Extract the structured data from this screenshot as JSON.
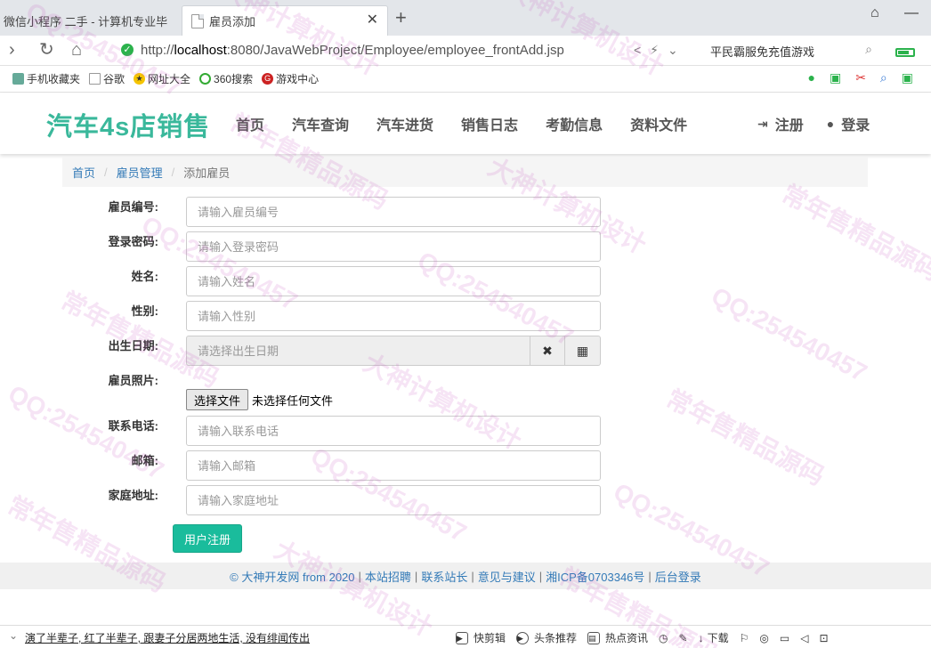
{
  "browser": {
    "tabs": [
      {
        "label": "微信小程序 二手 - 计算机专业毕",
        "active": false
      },
      {
        "label": "雇员添加",
        "active": true
      }
    ],
    "url_prefix": "http://",
    "url_host": "localhost",
    "url_path": ":8080/JavaWebProject/Employee/employee_frontAdd.jsp",
    "search_text": "平民霸服免充值游戏",
    "bookmarks": [
      {
        "label": "手机收藏夹",
        "icon": "phone-icon"
      },
      {
        "label": "谷歌",
        "icon": "page-icon"
      },
      {
        "label": "网址大全",
        "icon": "star-icon"
      },
      {
        "label": "360搜索",
        "icon": "search-360-icon"
      },
      {
        "label": "游戏中心",
        "icon": "game-icon"
      }
    ]
  },
  "site": {
    "logo": "汽车4s店销售",
    "nav": [
      "首页",
      "汽车查询",
      "汽车进货",
      "销售日志",
      "考勤信息",
      "资料文件"
    ],
    "register": "注册",
    "login": "登录"
  },
  "breadcrumb": {
    "home": "首页",
    "section": "雇员管理",
    "current": "添加雇员"
  },
  "form": {
    "employee_no": {
      "label": "雇员编号:",
      "placeholder": "请输入雇员编号"
    },
    "password": {
      "label": "登录密码:",
      "placeholder": "请输入登录密码"
    },
    "name": {
      "label": "姓名:",
      "placeholder": "请输入姓名"
    },
    "gender": {
      "label": "性别:",
      "placeholder": "请输入性别"
    },
    "birthday": {
      "label": "出生日期:",
      "placeholder": "请选择出生日期"
    },
    "photo": {
      "label": "雇员照片:",
      "button": "选择文件",
      "status": "未选择任何文件"
    },
    "phone": {
      "label": "联系电话:",
      "placeholder": "请输入联系电话"
    },
    "email": {
      "label": "邮箱:",
      "placeholder": "请输入邮箱"
    },
    "address": {
      "label": "家庭地址:",
      "placeholder": "请输入家庭地址"
    },
    "submit": "用户注册"
  },
  "footer": {
    "copyright": "© 大神开发网 from 2020",
    "links": [
      "本站招聘",
      "联系站长",
      "意见与建议",
      "湘ICP备0703346号",
      "后台登录"
    ]
  },
  "statusbar": {
    "news": "演了半辈子, 红了半辈子, 跟妻子分居两地生活, 没有绯闻传出",
    "tools": [
      "快剪辑",
      "头条推荐",
      "热点资讯",
      "下载"
    ]
  },
  "watermark": {
    "texts": [
      "常年售精品源码",
      "QQ:254540457",
      "大神计算机设计"
    ]
  },
  "colors": {
    "logo": "#3ab89b",
    "submit": "#1abc9c",
    "link": "#337ab7"
  }
}
